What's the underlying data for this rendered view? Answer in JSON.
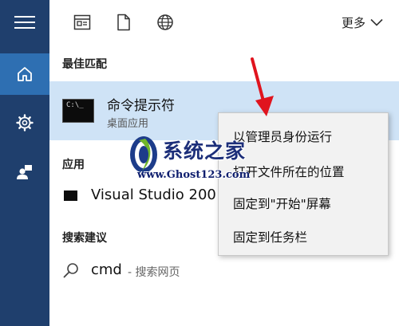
{
  "toolbar": {
    "more_label": "更多"
  },
  "sections": {
    "best_match": "最佳匹配",
    "apps": "应用",
    "search_suggestions": "搜索建议"
  },
  "best_match": {
    "title": "命令提示符",
    "subtitle": "桌面应用"
  },
  "apps": {
    "visual_studio": "Visual Studio 200"
  },
  "search_suggestion": {
    "query": "cmd",
    "suffix": "- 搜索网页"
  },
  "context_menu": {
    "items": [
      "以管理员身份运行",
      "打开文件所在的位置",
      "固定到\"开始\"屏幕",
      "固定到任务栏"
    ]
  },
  "watermark": {
    "title": "系统之家",
    "url": "www.Ghost123.com"
  },
  "colors": {
    "rail": "#1f3f6d",
    "rail_active": "#2e6fb2",
    "selection": "#cfe3f6",
    "annotation_arrow": "#e0141e"
  },
  "icons": [
    "hamburger-menu-icon",
    "home-icon",
    "gear-icon",
    "user-icon",
    "document-icon",
    "page-icon",
    "globe-icon",
    "chevron-down-icon",
    "search-icon",
    "console-icon"
  ]
}
